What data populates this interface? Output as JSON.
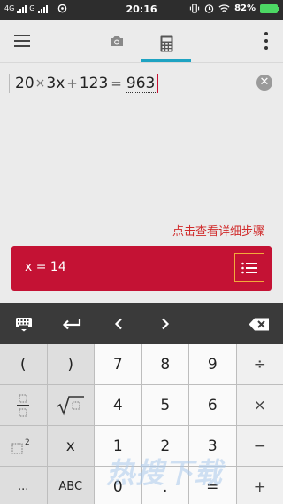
{
  "status_bar": {
    "network_1": "4G",
    "network_2": "G",
    "time": "20:16",
    "battery": "82%"
  },
  "toolbar": {
    "tabs": [
      {
        "icon": "camera-icon"
      },
      {
        "icon": "calculator-icon",
        "selected": true
      }
    ],
    "accent_color": "#1ea3c2"
  },
  "expression": {
    "tokens": [
      "20",
      "×",
      "3x",
      "+",
      "123",
      "="
    ],
    "answer": "963"
  },
  "steps_link": "点击查看详细步骤",
  "result": {
    "text": "x = 14",
    "color": "#c41234"
  },
  "keypad": {
    "rows": [
      [
        "(",
        ")",
        "7",
        "8",
        "9",
        "÷"
      ],
      [
        "fraction",
        "sqrt",
        "4",
        "5",
        "6",
        "×"
      ],
      [
        "power",
        "x",
        "1",
        "2",
        "3",
        "−"
      ],
      [
        "...",
        "ABC",
        "0",
        ".",
        "=",
        "+"
      ]
    ]
  },
  "watermark": "热搜下载"
}
